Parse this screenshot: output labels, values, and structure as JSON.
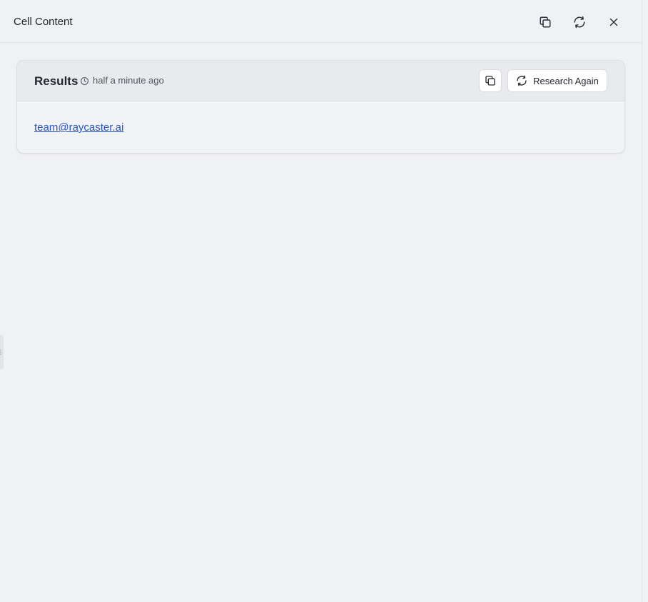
{
  "header": {
    "title": "Cell Content",
    "actions": [
      {
        "name": "copy-icon"
      },
      {
        "name": "refresh-icon"
      },
      {
        "name": "close-icon"
      }
    ]
  },
  "results": {
    "title": "Results",
    "timestamp": "half a minute ago",
    "copy_icon": "copy-icon",
    "research_label": "Research Again",
    "research_icon": "refresh-icon",
    "value": "team@raycaster.ai"
  },
  "colors": {
    "background": "#f0f1f5",
    "card_header": "#e9eaee",
    "link": "#2453c9"
  }
}
